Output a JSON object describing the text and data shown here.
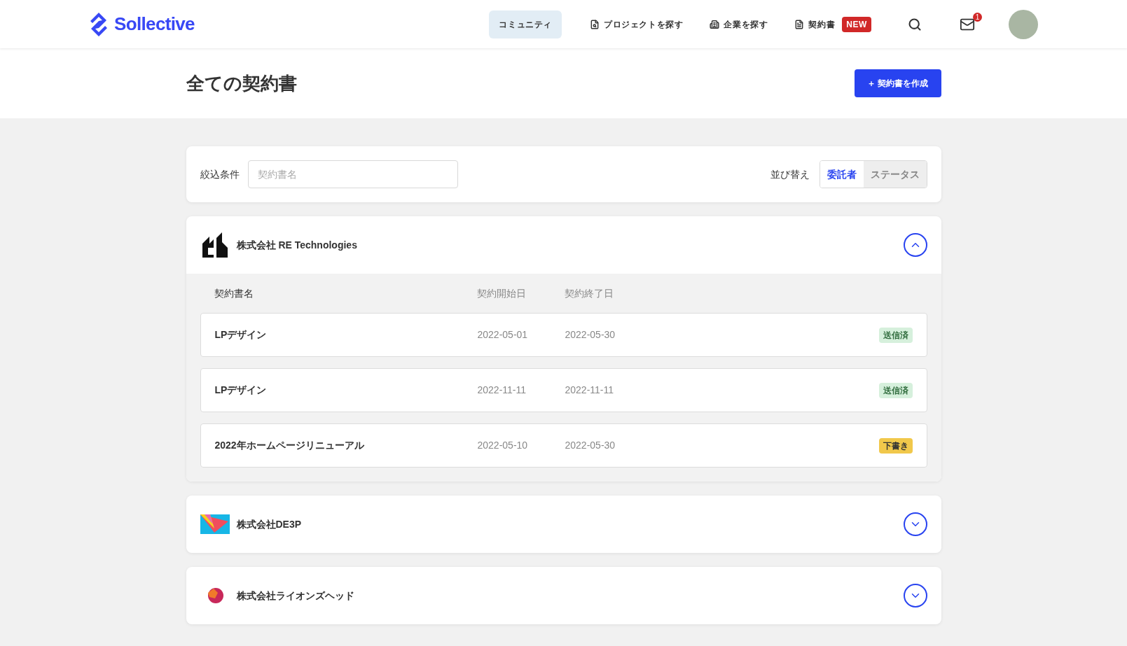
{
  "header": {
    "logo": "Sollective",
    "nav": [
      {
        "label": "コミュニティ",
        "selected": true
      },
      {
        "label": "プロジェクトを探す",
        "selected": false
      },
      {
        "label": "企業を探す",
        "selected": false
      },
      {
        "label": "契約書",
        "selected": false,
        "badge": "NEW"
      }
    ],
    "mail_count": "1"
  },
  "page": {
    "title": "全ての契約書",
    "create_button": "＋ 契約書を作成"
  },
  "filter": {
    "label": "絞込条件",
    "placeholder": "契約書名",
    "sort_label": "並び替え",
    "sort_options": [
      {
        "label": "委託者",
        "selected": true
      },
      {
        "label": "ステータス",
        "selected": false
      }
    ]
  },
  "companies": [
    {
      "name": "株式会社 RE Technologies",
      "expanded": true,
      "columns": [
        "契約書名",
        "契約開始日",
        "契約終了日"
      ],
      "contracts": [
        {
          "name": "LPデザイン",
          "start": "2022-05-01",
          "end": "2022-05-30",
          "status": "送信済",
          "kind": "sent"
        },
        {
          "name": "LPデザイン",
          "start": "2022-11-11",
          "end": "2022-11-11",
          "status": "送信済",
          "kind": "sent"
        },
        {
          "name": "2022年ホームページリニューアル",
          "start": "2022-05-10",
          "end": "2022-05-30",
          "status": "下書き",
          "kind": "draft"
        }
      ]
    },
    {
      "name": "株式会社DE3P",
      "expanded": false
    },
    {
      "name": "株式会社ライオンズヘッド",
      "expanded": false
    }
  ]
}
